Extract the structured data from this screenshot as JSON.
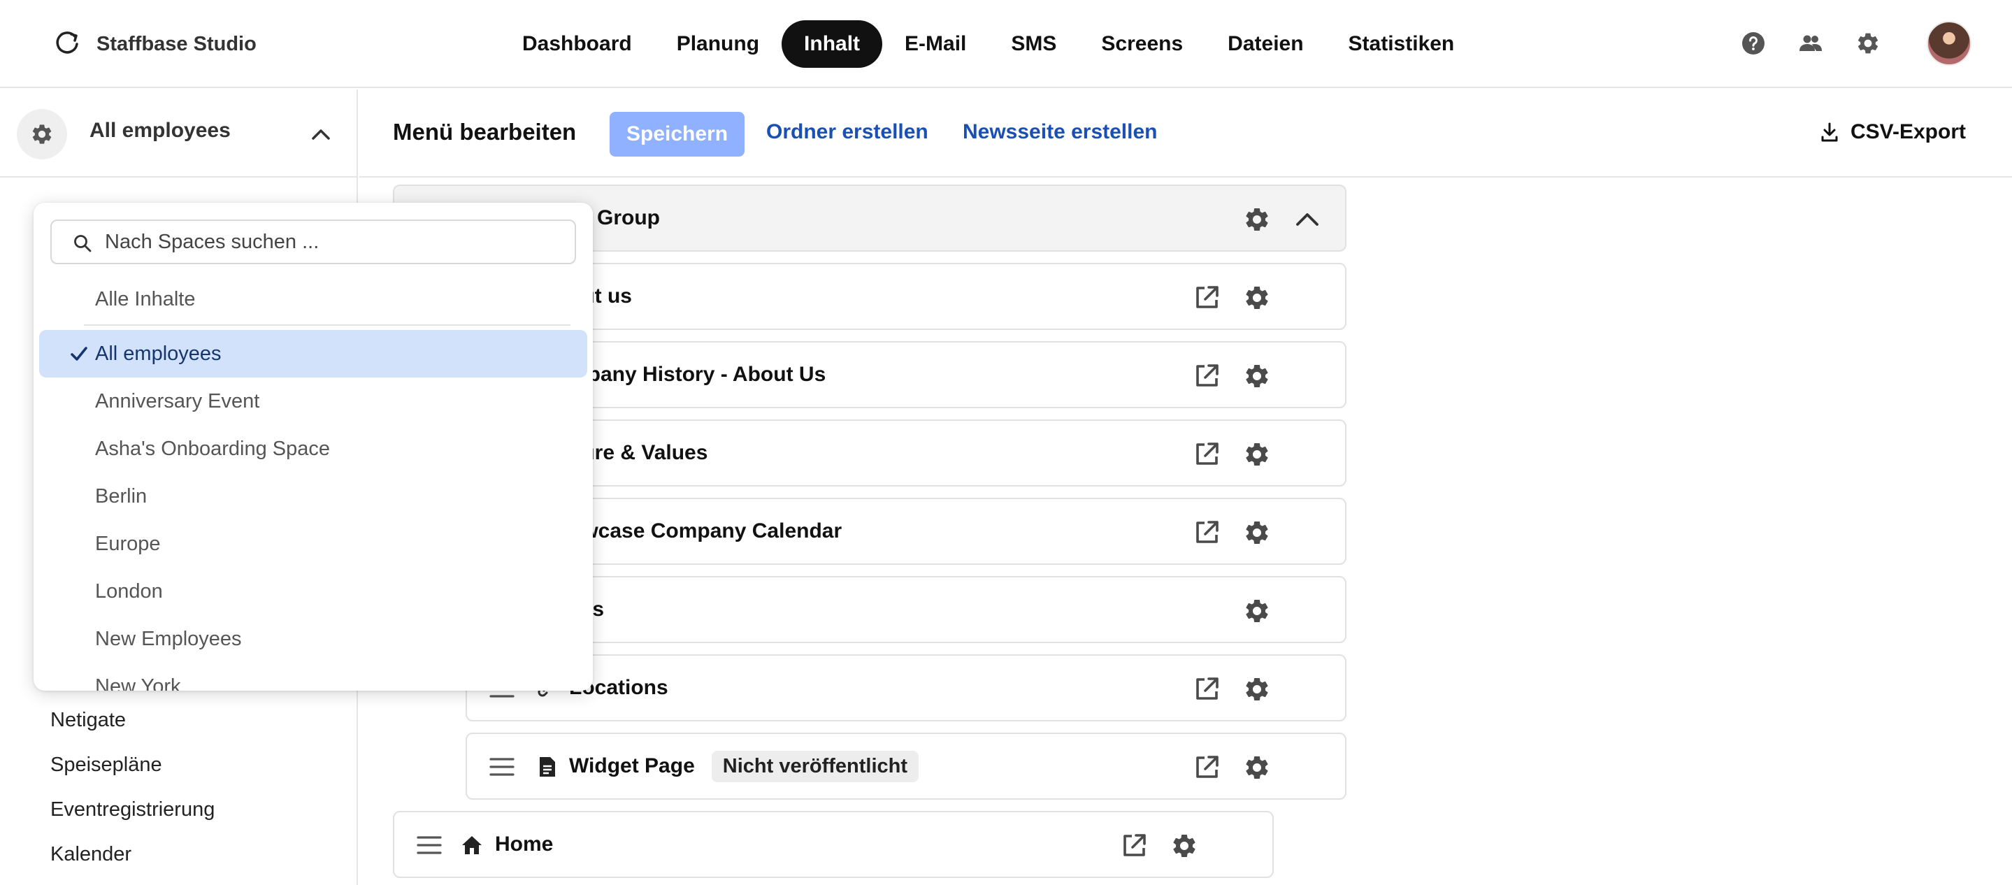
{
  "app": {
    "brand_name": "Staffbase Studio"
  },
  "nav": {
    "items": [
      "Dashboard",
      "Planung",
      "Inhalt",
      "E-Mail",
      "SMS",
      "Screens",
      "Dateien",
      "Statistiken"
    ],
    "active": "Inhalt"
  },
  "header_icons": [
    "help-icon",
    "users-icon",
    "gear-icon",
    "avatar"
  ],
  "sidebar": {
    "space_name": "All employees",
    "links": [
      "Netigate",
      "Speisepläne",
      "Eventregistrierung",
      "Kalender"
    ]
  },
  "toolbar": {
    "title": "Menü bearbeiten",
    "save_label": "Speichern",
    "create_folder_label": "Ordner erstellen",
    "create_newspage_label": "Newsseite erstellen",
    "export_label": "CSV-Export"
  },
  "menu": {
    "group_label": "Group",
    "rows": [
      {
        "label": "out us",
        "external": true
      },
      {
        "label": "mpany History - About Us",
        "external": true
      },
      {
        "label": "lture & Values",
        "external": true
      },
      {
        "label": "owcase Company Calendar",
        "external": true
      },
      {
        "label": "ess",
        "external": false
      },
      {
        "label": "Locations",
        "external": true
      },
      {
        "label": "Widget Page",
        "external": true,
        "badge": "Nicht veröffentlicht"
      }
    ],
    "home_label": "Home"
  },
  "dropdown": {
    "search_placeholder": "Nach Spaces suchen ...",
    "all_content_label": "Alle Inhalte",
    "selected": "All employees",
    "options": [
      "All employees",
      "Anniversary Event",
      "Asha's Onboarding Space",
      "Berlin",
      "Europe",
      "London",
      "New Employees",
      "New York"
    ]
  },
  "colors": {
    "nav_active_bg": "#111111",
    "save_button_bg": "#8fb1ff",
    "link_color": "#1a4fb4",
    "selected_option_bg": "#d3e2fb"
  }
}
